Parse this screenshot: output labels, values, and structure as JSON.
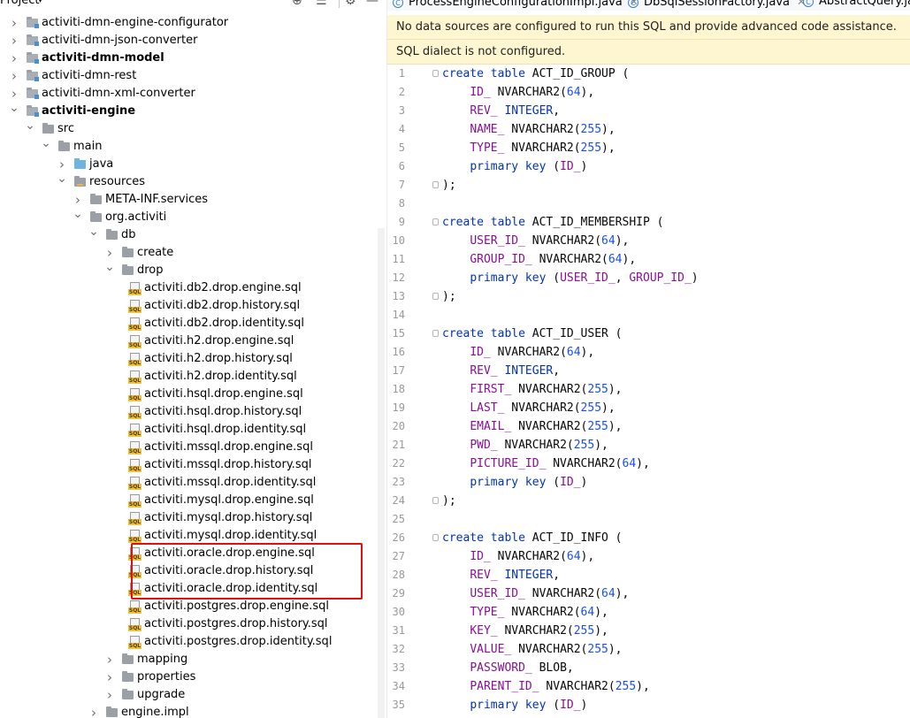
{
  "project_panel": {
    "title": "Project",
    "caret": "▾",
    "icons": [
      "target-icon",
      "collapse-all-icon",
      "gear-icon",
      "minimize-icon"
    ]
  },
  "tree": [
    {
      "label": "activiti-dmn-engine-configurator",
      "type": "module",
      "depth": 0,
      "arrow": "›",
      "bold": false
    },
    {
      "label": "activiti-dmn-json-converter",
      "type": "module",
      "depth": 0,
      "arrow": "›",
      "bold": false
    },
    {
      "label": "activiti-dmn-model",
      "type": "module",
      "depth": 0,
      "arrow": "›",
      "bold": true
    },
    {
      "label": "activiti-dmn-rest",
      "type": "module",
      "depth": 0,
      "arrow": "›",
      "bold": false
    },
    {
      "label": "activiti-dmn-xml-converter",
      "type": "module",
      "depth": 0,
      "arrow": "›",
      "bold": false
    },
    {
      "label": "activiti-engine",
      "type": "module",
      "depth": 0,
      "arrow": "⌄",
      "bold": true
    },
    {
      "label": "src",
      "type": "folder",
      "depth": 1,
      "arrow": "⌄",
      "bold": false
    },
    {
      "label": "main",
      "type": "folder",
      "depth": 2,
      "arrow": "⌄",
      "bold": false
    },
    {
      "label": "java",
      "type": "java",
      "depth": 3,
      "arrow": "›",
      "bold": false
    },
    {
      "label": "resources",
      "type": "resources",
      "depth": 3,
      "arrow": "⌄",
      "bold": false
    },
    {
      "label": "META-INF.services",
      "type": "folder",
      "depth": 4,
      "arrow": "›",
      "bold": false
    },
    {
      "label": "org.activiti",
      "type": "folder",
      "depth": 4,
      "arrow": "⌄",
      "bold": false
    },
    {
      "label": "db",
      "type": "folder",
      "depth": 5,
      "arrow": "⌄",
      "bold": false
    },
    {
      "label": "create",
      "type": "folder",
      "depth": 6,
      "arrow": "›",
      "bold": false
    },
    {
      "label": "drop",
      "type": "folder",
      "depth": 6,
      "arrow": "⌄",
      "bold": false
    },
    {
      "label": "activiti.db2.drop.engine.sql",
      "type": "sql",
      "depth": 7,
      "arrow": "",
      "bold": false
    },
    {
      "label": "activiti.db2.drop.history.sql",
      "type": "sql",
      "depth": 7,
      "arrow": "",
      "bold": false
    },
    {
      "label": "activiti.db2.drop.identity.sql",
      "type": "sql",
      "depth": 7,
      "arrow": "",
      "bold": false
    },
    {
      "label": "activiti.h2.drop.engine.sql",
      "type": "sql",
      "depth": 7,
      "arrow": "",
      "bold": false
    },
    {
      "label": "activiti.h2.drop.history.sql",
      "type": "sql",
      "depth": 7,
      "arrow": "",
      "bold": false
    },
    {
      "label": "activiti.h2.drop.identity.sql",
      "type": "sql",
      "depth": 7,
      "arrow": "",
      "bold": false
    },
    {
      "label": "activiti.hsql.drop.engine.sql",
      "type": "sql",
      "depth": 7,
      "arrow": "",
      "bold": false
    },
    {
      "label": "activiti.hsql.drop.history.sql",
      "type": "sql",
      "depth": 7,
      "arrow": "",
      "bold": false
    },
    {
      "label": "activiti.hsql.drop.identity.sql",
      "type": "sql",
      "depth": 7,
      "arrow": "",
      "bold": false
    },
    {
      "label": "activiti.mssql.drop.engine.sql",
      "type": "sql",
      "depth": 7,
      "arrow": "",
      "bold": false
    },
    {
      "label": "activiti.mssql.drop.history.sql",
      "type": "sql",
      "depth": 7,
      "arrow": "",
      "bold": false
    },
    {
      "label": "activiti.mssql.drop.identity.sql",
      "type": "sql",
      "depth": 7,
      "arrow": "",
      "bold": false
    },
    {
      "label": "activiti.mysql.drop.engine.sql",
      "type": "sql",
      "depth": 7,
      "arrow": "",
      "bold": false
    },
    {
      "label": "activiti.mysql.drop.history.sql",
      "type": "sql",
      "depth": 7,
      "arrow": "",
      "bold": false
    },
    {
      "label": "activiti.mysql.drop.identity.sql",
      "type": "sql",
      "depth": 7,
      "arrow": "",
      "bold": false
    },
    {
      "label": "activiti.oracle.drop.engine.sql",
      "type": "sql",
      "depth": 7,
      "arrow": "",
      "bold": false
    },
    {
      "label": "activiti.oracle.drop.history.sql",
      "type": "sql",
      "depth": 7,
      "arrow": "",
      "bold": false
    },
    {
      "label": "activiti.oracle.drop.identity.sql",
      "type": "sql",
      "depth": 7,
      "arrow": "",
      "bold": false
    },
    {
      "label": "activiti.postgres.drop.engine.sql",
      "type": "sql",
      "depth": 7,
      "arrow": "",
      "bold": false
    },
    {
      "label": "activiti.postgres.drop.history.sql",
      "type": "sql",
      "depth": 7,
      "arrow": "",
      "bold": false
    },
    {
      "label": "activiti.postgres.drop.identity.sql",
      "type": "sql",
      "depth": 7,
      "arrow": "",
      "bold": false
    },
    {
      "label": "mapping",
      "type": "folder",
      "depth": 6,
      "arrow": "›",
      "bold": false
    },
    {
      "label": "properties",
      "type": "folder",
      "depth": 6,
      "arrow": "›",
      "bold": false
    },
    {
      "label": "upgrade",
      "type": "folder",
      "depth": 6,
      "arrow": "›",
      "bold": false
    },
    {
      "label": "engine.impl",
      "type": "folder",
      "depth": 5,
      "arrow": "›",
      "bold": false
    }
  ],
  "tabs": [
    {
      "label": "ProcessEngineConfigurationImpl.java",
      "closable": true
    },
    {
      "label": "DbSqlSessionFactory.java",
      "closable": true
    },
    {
      "label": "AbstractQuery.java",
      "closable": false
    }
  ],
  "notices": [
    "No data sources are configured to run this SQL and provide advanced code assistance.",
    "SQL dialect is not configured."
  ],
  "code_lines": [
    {
      "n": "1",
      "fold": true,
      "tokens": [
        [
          "kw",
          "create"
        ],
        [
          "t",
          " "
        ],
        [
          "kw",
          "table"
        ],
        [
          "t",
          " ACT_ID_GROUP ("
        ]
      ]
    },
    {
      "n": "2",
      "fold": false,
      "tokens": [
        [
          "t",
          "    "
        ],
        [
          "col",
          "ID_"
        ],
        [
          "t",
          " NVARCHAR2("
        ],
        [
          "num",
          "64"
        ],
        [
          "t",
          "),"
        ]
      ]
    },
    {
      "n": "3",
      "fold": false,
      "tokens": [
        [
          "t",
          "    "
        ],
        [
          "col",
          "REV_"
        ],
        [
          "t",
          " "
        ],
        [
          "kw",
          "INTEGER"
        ],
        [
          "t",
          ","
        ]
      ]
    },
    {
      "n": "4",
      "fold": false,
      "tokens": [
        [
          "t",
          "    "
        ],
        [
          "col",
          "NAME_"
        ],
        [
          "t",
          " NVARCHAR2("
        ],
        [
          "num",
          "255"
        ],
        [
          "t",
          "),"
        ]
      ]
    },
    {
      "n": "5",
      "fold": false,
      "tokens": [
        [
          "t",
          "    "
        ],
        [
          "col",
          "TYPE_"
        ],
        [
          "t",
          " NVARCHAR2("
        ],
        [
          "num",
          "255"
        ],
        [
          "t",
          "),"
        ]
      ]
    },
    {
      "n": "6",
      "fold": false,
      "tokens": [
        [
          "t",
          "    "
        ],
        [
          "kw",
          "primary key"
        ],
        [
          "t",
          " ("
        ],
        [
          "col",
          "ID_"
        ],
        [
          "t",
          ")"
        ]
      ]
    },
    {
      "n": "7",
      "fold": true,
      "tokens": [
        [
          "t",
          ");"
        ]
      ]
    },
    {
      "n": "8",
      "fold": false,
      "tokens": []
    },
    {
      "n": "9",
      "fold": true,
      "tokens": [
        [
          "kw",
          "create"
        ],
        [
          "t",
          " "
        ],
        [
          "kw",
          "table"
        ],
        [
          "t",
          " ACT_ID_MEMBERSHIP ("
        ]
      ]
    },
    {
      "n": "10",
      "fold": false,
      "tokens": [
        [
          "t",
          "    "
        ],
        [
          "col",
          "USER_ID_"
        ],
        [
          "t",
          " NVARCHAR2("
        ],
        [
          "num",
          "64"
        ],
        [
          "t",
          "),"
        ]
      ]
    },
    {
      "n": "11",
      "fold": false,
      "tokens": [
        [
          "t",
          "    "
        ],
        [
          "col",
          "GROUP_ID_"
        ],
        [
          "t",
          " NVARCHAR2("
        ],
        [
          "num",
          "64"
        ],
        [
          "t",
          "),"
        ]
      ]
    },
    {
      "n": "12",
      "fold": false,
      "tokens": [
        [
          "t",
          "    "
        ],
        [
          "kw",
          "primary key"
        ],
        [
          "t",
          " ("
        ],
        [
          "col",
          "USER_ID_"
        ],
        [
          "t",
          ", "
        ],
        [
          "col",
          "GROUP_ID_"
        ],
        [
          "t",
          ")"
        ]
      ]
    },
    {
      "n": "13",
      "fold": true,
      "tokens": [
        [
          "t",
          ");"
        ]
      ]
    },
    {
      "n": "14",
      "fold": false,
      "tokens": []
    },
    {
      "n": "15",
      "fold": true,
      "tokens": [
        [
          "kw",
          "create"
        ],
        [
          "t",
          " "
        ],
        [
          "kw",
          "table"
        ],
        [
          "t",
          " ACT_ID_USER ("
        ]
      ]
    },
    {
      "n": "16",
      "fold": false,
      "tokens": [
        [
          "t",
          "    "
        ],
        [
          "col",
          "ID_"
        ],
        [
          "t",
          " NVARCHAR2("
        ],
        [
          "num",
          "64"
        ],
        [
          "t",
          "),"
        ]
      ]
    },
    {
      "n": "17",
      "fold": false,
      "tokens": [
        [
          "t",
          "    "
        ],
        [
          "col",
          "REV_"
        ],
        [
          "t",
          " "
        ],
        [
          "kw",
          "INTEGER"
        ],
        [
          "t",
          ","
        ]
      ]
    },
    {
      "n": "18",
      "fold": false,
      "tokens": [
        [
          "t",
          "    "
        ],
        [
          "col",
          "FIRST_"
        ],
        [
          "t",
          " NVARCHAR2("
        ],
        [
          "num",
          "255"
        ],
        [
          "t",
          "),"
        ]
      ]
    },
    {
      "n": "19",
      "fold": false,
      "tokens": [
        [
          "t",
          "    "
        ],
        [
          "col",
          "LAST_"
        ],
        [
          "t",
          " NVARCHAR2("
        ],
        [
          "num",
          "255"
        ],
        [
          "t",
          "),"
        ]
      ]
    },
    {
      "n": "20",
      "fold": false,
      "tokens": [
        [
          "t",
          "    "
        ],
        [
          "col",
          "EMAIL_"
        ],
        [
          "t",
          " NVARCHAR2("
        ],
        [
          "num",
          "255"
        ],
        [
          "t",
          "),"
        ]
      ]
    },
    {
      "n": "21",
      "fold": false,
      "tokens": [
        [
          "t",
          "    "
        ],
        [
          "col",
          "PWD_"
        ],
        [
          "t",
          " NVARCHAR2("
        ],
        [
          "num",
          "255"
        ],
        [
          "t",
          "),"
        ]
      ]
    },
    {
      "n": "22",
      "fold": false,
      "tokens": [
        [
          "t",
          "    "
        ],
        [
          "col",
          "PICTURE_ID_"
        ],
        [
          "t",
          " NVARCHAR2("
        ],
        [
          "num",
          "64"
        ],
        [
          "t",
          "),"
        ]
      ]
    },
    {
      "n": "23",
      "fold": false,
      "tokens": [
        [
          "t",
          "    "
        ],
        [
          "kw",
          "primary key"
        ],
        [
          "t",
          " ("
        ],
        [
          "col",
          "ID_"
        ],
        [
          "t",
          ")"
        ]
      ]
    },
    {
      "n": "24",
      "fold": true,
      "tokens": [
        [
          "t",
          ");"
        ]
      ]
    },
    {
      "n": "25",
      "fold": false,
      "tokens": []
    },
    {
      "n": "26",
      "fold": true,
      "tokens": [
        [
          "kw",
          "create"
        ],
        [
          "t",
          " "
        ],
        [
          "kw",
          "table"
        ],
        [
          "t",
          " ACT_ID_INFO ("
        ]
      ]
    },
    {
      "n": "27",
      "fold": false,
      "tokens": [
        [
          "t",
          "    "
        ],
        [
          "col",
          "ID_"
        ],
        [
          "t",
          " NVARCHAR2("
        ],
        [
          "num",
          "64"
        ],
        [
          "t",
          "),"
        ]
      ]
    },
    {
      "n": "28",
      "fold": false,
      "tokens": [
        [
          "t",
          "    "
        ],
        [
          "col",
          "REV_"
        ],
        [
          "t",
          " "
        ],
        [
          "kw",
          "INTEGER"
        ],
        [
          "t",
          ","
        ]
      ]
    },
    {
      "n": "29",
      "fold": false,
      "tokens": [
        [
          "t",
          "    "
        ],
        [
          "col",
          "USER_ID_"
        ],
        [
          "t",
          " NVARCHAR2("
        ],
        [
          "num",
          "64"
        ],
        [
          "t",
          "),"
        ]
      ]
    },
    {
      "n": "30",
      "fold": false,
      "tokens": [
        [
          "t",
          "    "
        ],
        [
          "col",
          "TYPE_"
        ],
        [
          "t",
          " NVARCHAR2("
        ],
        [
          "num",
          "64"
        ],
        [
          "t",
          "),"
        ]
      ]
    },
    {
      "n": "31",
      "fold": false,
      "tokens": [
        [
          "t",
          "    "
        ],
        [
          "col",
          "KEY_"
        ],
        [
          "t",
          " NVARCHAR2("
        ],
        [
          "num",
          "255"
        ],
        [
          "t",
          "),"
        ]
      ]
    },
    {
      "n": "32",
      "fold": false,
      "tokens": [
        [
          "t",
          "    "
        ],
        [
          "col",
          "VALUE_"
        ],
        [
          "t",
          " NVARCHAR2("
        ],
        [
          "num",
          "255"
        ],
        [
          "t",
          "),"
        ]
      ]
    },
    {
      "n": "33",
      "fold": false,
      "tokens": [
        [
          "t",
          "    "
        ],
        [
          "col",
          "PASSWORD_"
        ],
        [
          "t",
          " BLOB,"
        ]
      ]
    },
    {
      "n": "34",
      "fold": false,
      "tokens": [
        [
          "t",
          "    "
        ],
        [
          "col",
          "PARENT_ID_"
        ],
        [
          "t",
          " NVARCHAR2("
        ],
        [
          "num",
          "255"
        ],
        [
          "t",
          "),"
        ]
      ]
    },
    {
      "n": "35",
      "fold": false,
      "tokens": [
        [
          "t",
          "    "
        ],
        [
          "kw",
          "primary key"
        ],
        [
          "t",
          " ("
        ],
        [
          "col",
          "ID_"
        ],
        [
          "t",
          ")"
        ]
      ]
    }
  ],
  "colors": {
    "keyword": "#0033b3",
    "column": "#871094",
    "number": "#1750eb",
    "notice_bg": "#fdf6d0",
    "highlight_box": "#e01010"
  }
}
